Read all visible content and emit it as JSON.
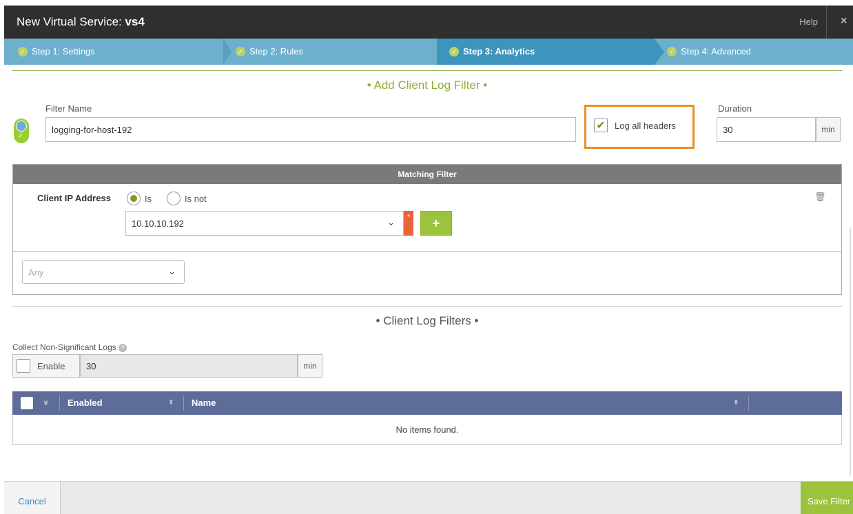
{
  "window": {
    "title_prefix": "New Virtual Service: ",
    "title_name": "vs4",
    "help_label": "Help",
    "close_label": "×"
  },
  "steps": [
    {
      "label": "Step 1: Settings"
    },
    {
      "label": "Step 2: Rules"
    },
    {
      "label": "Step 3: Analytics"
    },
    {
      "label": "Step 4: Advanced"
    }
  ],
  "add_filter": {
    "section_title": "• Add Client Log Filter •",
    "filter_name_label": "Filter Name",
    "filter_name_value": "logging-for-host-192",
    "log_all_headers_label": "Log all headers",
    "log_all_headers_checked": true,
    "duration_label": "Duration",
    "duration_value": "30",
    "duration_unit": "min"
  },
  "matching_filter": {
    "header": "Matching Filter",
    "client_ip_label": "Client IP Address",
    "radio_is": "Is",
    "radio_is_not": "Is not",
    "ip_value": "10.10.10.192",
    "required_mark": "*",
    "add_label": "+",
    "any_placeholder": "Any"
  },
  "client_log_filters": {
    "section_title": "• Client Log Filters •",
    "collect_label": "Collect Non-Significant Logs",
    "enable_label": "Enable",
    "enable_value": "30",
    "enable_unit": "min"
  },
  "table": {
    "col_enabled": "Enabled",
    "col_name": "Name",
    "empty_text": "No items found."
  },
  "footer": {
    "cancel_label": "Cancel",
    "save_label": "Save Filter"
  },
  "colors": {
    "accent_green": "#9cc33c",
    "step_blue": "#6db0ce",
    "highlight_orange": "#f08a24",
    "table_header": "#5e6c99"
  }
}
